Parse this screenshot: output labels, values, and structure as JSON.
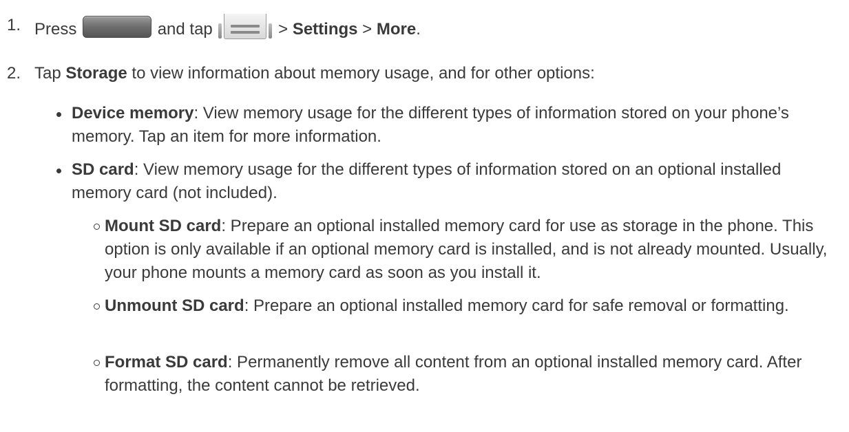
{
  "step1": {
    "number": "1.",
    "press": "Press",
    "and_tap": "and tap",
    "sep1": ">",
    "settings": "Settings",
    "sep2": ">",
    "more": "More",
    "end": "."
  },
  "step2": {
    "number": "2.",
    "tap": "Tap",
    "storage": "Storage",
    "rest": "to view information about memory usage, and for other options:"
  },
  "bullets": [
    {
      "term": "Device memory",
      "desc": ": View memory usage for the different types of information stored on your phone’s memory. Tap an item for more information."
    },
    {
      "term": "SD card",
      "desc": ": View memory usage for the different types of information stored on an optional installed memory card (not included)."
    }
  ],
  "sub_bullets": [
    {
      "term": "Mount SD card",
      "desc": ": Prepare an optional installed memory card for use as storage in the phone. This option is only available if an optional memory card is installed, and is not already mounted. Usually, your phone mounts a memory card as soon as you install it."
    },
    {
      "term": "Unmount SD card",
      "desc": ": Prepare an optional installed memory card for safe removal or formatting."
    },
    {
      "term": "Format SD card",
      "desc": ": Permanently remove all content from an optional installed memory card. After formatting, the content cannot be retrieved."
    }
  ],
  "icons": {
    "home": "home-button-icon",
    "menu": "menu-key-icon"
  }
}
